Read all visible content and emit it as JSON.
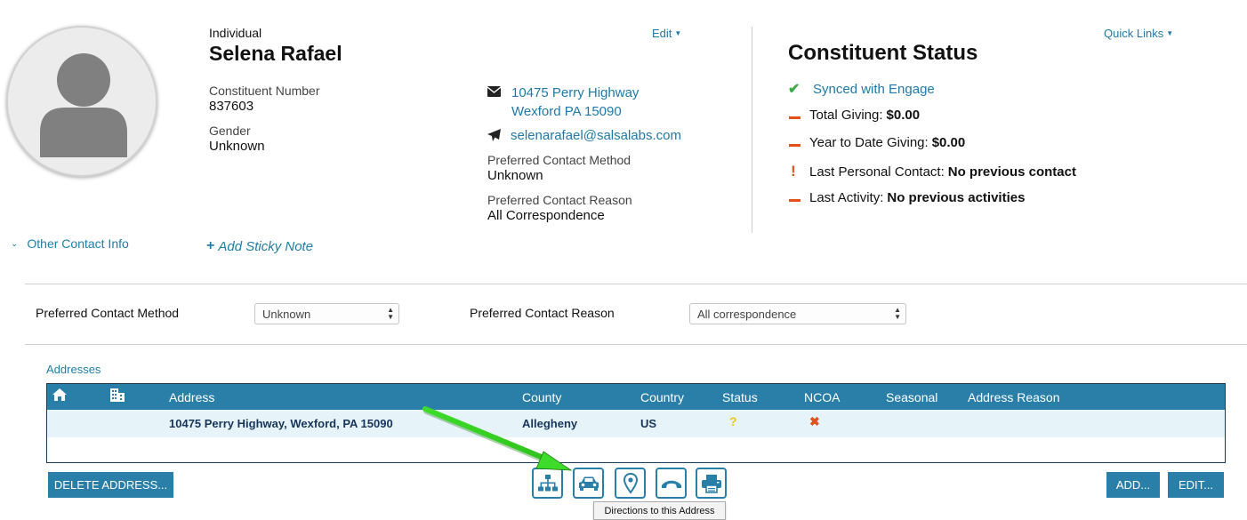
{
  "profile": {
    "type": "Individual",
    "name": "Selena Rafael",
    "constituent_number_label": "Constituent Number",
    "constituent_number": "837603",
    "gender_label": "Gender",
    "gender": "Unknown",
    "edit_label": "Edit"
  },
  "contact": {
    "address_line1": "10475 Perry Highway",
    "address_line2": "Wexford  PA  15090",
    "email": "selenarafael@salsalabs.com",
    "preferred_method_label": "Preferred Contact Method",
    "preferred_method": "Unknown",
    "preferred_reason_label": "Preferred Contact Reason",
    "preferred_reason": "All Correspondence"
  },
  "status": {
    "quick_links": "Quick Links",
    "title": "Constituent Status",
    "synced": "Synced with Engage",
    "total_giving_label": "Total Giving:",
    "total_giving": "$0.00",
    "ytd_giving_label": "Year to Date Giving:",
    "ytd_giving": "$0.00",
    "last_contact_label": "Last Personal Contact:",
    "last_contact": "No previous contact",
    "last_activity_label": "Last Activity:",
    "last_activity": "No previous activities"
  },
  "links": {
    "other_contact_info": "Other Contact Info",
    "add_sticky_note": "Add Sticky Note"
  },
  "preferences": {
    "method_label": "Preferred Contact Method",
    "method_value": "Unknown",
    "reason_label": "Preferred Contact Reason",
    "reason_value": "All correspondence"
  },
  "addresses": {
    "title": "Addresses",
    "columns": [
      "Address",
      "County",
      "Country",
      "Status",
      "NCOA",
      "Seasonal",
      "Address Reason"
    ],
    "rows": [
      {
        "address": "10475 Perry Highway, Wexford, PA 15090",
        "county": "Allegheny",
        "country": "US",
        "status": "?",
        "ncoa": "✖",
        "seasonal": "",
        "reason": ""
      }
    ]
  },
  "actions": {
    "delete": "DELETE ADDRESS...",
    "add": "ADD...",
    "edit": "EDIT...",
    "tooltip": "Directions to this Address"
  },
  "colors": {
    "accent": "#2a7fa8",
    "link": "#2079a8",
    "warning": "#e0511c",
    "success": "#3cab4a",
    "status_unknown": "#f0c419",
    "arrow": "#3ddc2a"
  },
  "icons": [
    "house-icon",
    "building-icon",
    "envelope-icon",
    "paper-plane-icon",
    "check-icon",
    "sitemap-icon",
    "car-icon",
    "map-pin-icon",
    "phone-icon",
    "printer-icon"
  ]
}
